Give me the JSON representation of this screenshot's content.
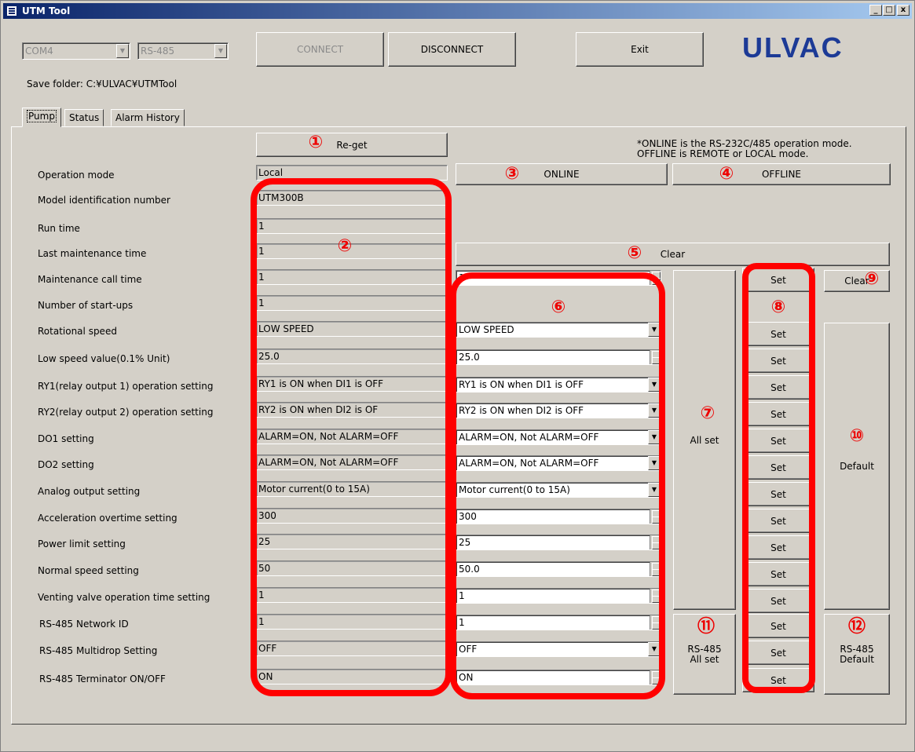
{
  "window": {
    "title": "UTM Tool",
    "min_label": "_",
    "max_label": "□",
    "close_label": "x"
  },
  "toolbar": {
    "port": "COM4",
    "interface": "RS-485",
    "connect_label": "CONNECT",
    "disconnect_label": "DISCONNECT",
    "exit_label": "Exit",
    "logo": "ULVAC"
  },
  "save_folder": "Save folder:  C:¥ULVAC¥UTMTool",
  "tabs": [
    "Pump",
    "Status",
    "Alarm History"
  ],
  "note": [
    "*ONLINE is the RS-232C/485 operation mode.",
    "OFFLINE is REMOTE or LOCAL mode."
  ],
  "buttons": {
    "reget": "Re-get",
    "online": "ONLINE",
    "offline": "OFFLINE",
    "clear_all": "Clear",
    "clear_one": "Clear",
    "all_set": "All set",
    "default": "Default",
    "rs485_all_set": "RS-485 All set",
    "rs485_default": "RS-485 Default",
    "set": "Set"
  },
  "rows": [
    {
      "label": "Operation mode",
      "current": "Local",
      "setting": ""
    },
    {
      "label": "Model identification number",
      "current": "UTM300B",
      "setting": ""
    },
    {
      "label": "Run time",
      "current": "1",
      "setting": ""
    },
    {
      "label": "Last maintenance time",
      "current": "1",
      "setting": ""
    },
    {
      "label": "Maintenance call time",
      "current": "1",
      "setting": "1"
    },
    {
      "label": "Number of start-ups",
      "current": "1",
      "setting": ""
    },
    {
      "label": "Rotational speed",
      "current": "LOW SPEED",
      "setting": "LOW SPEED"
    },
    {
      "label": "Low speed value(0.1% Unit)",
      "current": "25.0",
      "setting": "25.0"
    },
    {
      "label": "RY1(relay output 1) operation setting",
      "current": "RY1 is ON when DI1 is OFF",
      "setting": "RY1 is ON when DI1 is OFF"
    },
    {
      "label": "RY2(relay output 2) operation setting",
      "current": "RY2 is ON when DI2 is OF",
      "setting": "RY2 is ON when DI2 is OFF"
    },
    {
      "label": "DO1 setting",
      "current": "ALARM=ON, Not ALARM=OFF",
      "setting": "ALARM=ON, Not ALARM=OFF"
    },
    {
      "label": "DO2 setting",
      "current": "ALARM=ON, Not ALARM=OFF",
      "setting": "ALARM=ON, Not ALARM=OFF"
    },
    {
      "label": "Analog output setting",
      "current": "Motor current(0 to 15A)",
      "setting": "Motor current(0 to 15A)"
    },
    {
      "label": "Acceleration overtime setting",
      "current": "300",
      "setting": "300"
    },
    {
      "label": "Power limit setting",
      "current": "25",
      "setting": "25"
    },
    {
      "label": "Normal speed setting",
      "current": "50",
      "setting": "50.0"
    },
    {
      "label": "Venting valve operation time setting",
      "current": "1",
      "setting": "1"
    },
    {
      "label": "RS-485 Network ID",
      "current": "1",
      "setting": "1"
    },
    {
      "label": "RS-485 Multidrop Setting",
      "current": "OFF",
      "setting": "OFF"
    },
    {
      "label": "RS-485 Terminator ON/OFF",
      "current": "ON",
      "setting": "ON"
    }
  ],
  "annotations": [
    "①",
    "②",
    "③",
    "④",
    "⑤",
    "⑥",
    "⑦",
    "⑧",
    "⑨",
    "⑩",
    "⑪",
    "⑫"
  ],
  "colors": {
    "annotation": "#ff0000",
    "logo": "#1c3a96",
    "title_bar": "#0a246a"
  }
}
